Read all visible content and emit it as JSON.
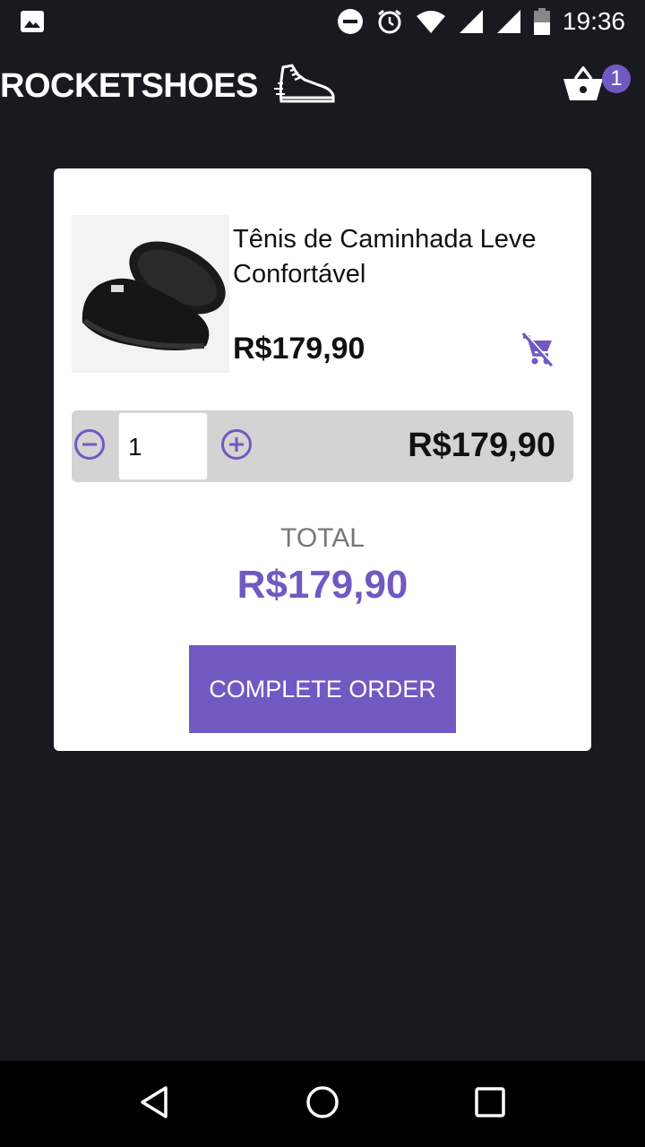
{
  "status_bar": {
    "time": "19:36",
    "left_icons": [
      "image-icon"
    ],
    "right_icons": [
      "do-not-disturb-icon",
      "alarm-icon",
      "wifi-icon",
      "signal-icon",
      "signal-icon-2",
      "battery-icon"
    ]
  },
  "header": {
    "logo_text": "ROCKETSHOES",
    "logo_icon": "sneaker-icon",
    "cart_count": "1",
    "cart_icon": "basket-icon"
  },
  "cart": {
    "items": [
      {
        "title": "Tênis de Caminhada Leve Confortável",
        "price": "R$179,90",
        "quantity": "1",
        "subtotal": "R$179,90",
        "image": "black-sneaker-image"
      }
    ],
    "total_label": "TOTAL",
    "total_value": "R$179,90",
    "complete_button": "COMPLETE ORDER"
  },
  "colors": {
    "accent": "#7159c1",
    "background": "#191920",
    "card": "#ffffff",
    "qty_row": "#d3d3d3"
  }
}
